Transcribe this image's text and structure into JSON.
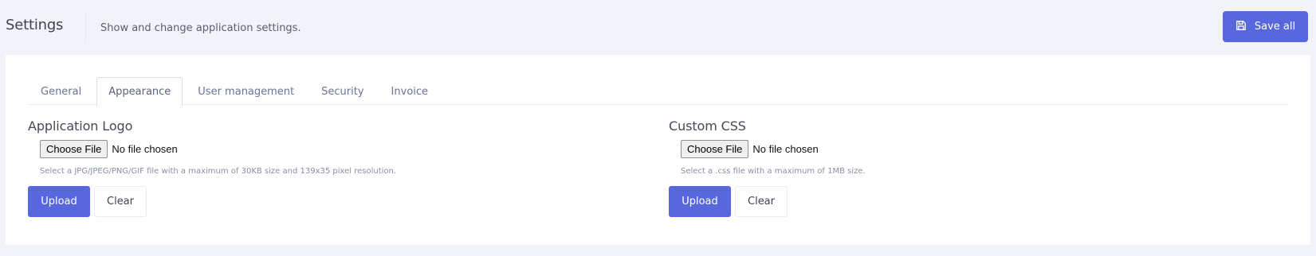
{
  "header": {
    "title": "Settings",
    "description": "Show and change application settings.",
    "save_all_label": "Save all",
    "save_icon": "floppy-disk-icon"
  },
  "tabs": [
    {
      "label": "General",
      "active": false
    },
    {
      "label": "Appearance",
      "active": true
    },
    {
      "label": "User management",
      "active": false
    },
    {
      "label": "Security",
      "active": false
    },
    {
      "label": "Invoice",
      "active": false
    }
  ],
  "logo_section": {
    "title": "Application Logo",
    "choose_label": "Choose File",
    "file_status": "No file chosen",
    "hint": "Select a JPG/JPEG/PNG/GIF file with a maximum of 30KB size and 139x35 pixel resolution.",
    "upload_label": "Upload",
    "clear_label": "Clear"
  },
  "css_section": {
    "title": "Custom CSS",
    "choose_label": "Choose File",
    "file_status": "No file chosen",
    "hint": "Select a .css file with a maximum of 1MB size.",
    "upload_label": "Upload",
    "clear_label": "Clear"
  },
  "colors": {
    "accent": "#5867dd",
    "background": "#f2f3f8",
    "card": "#ffffff"
  }
}
